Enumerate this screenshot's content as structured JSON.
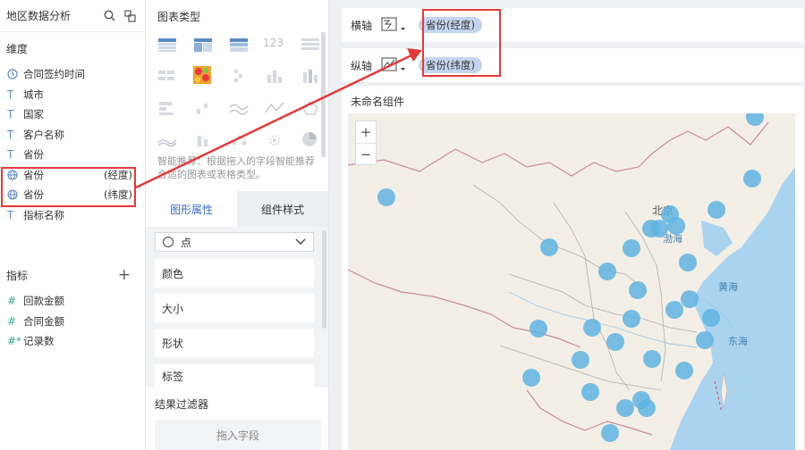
{
  "left": {
    "title": "地区数据分析",
    "dimension_label": "维度",
    "dimensions": [
      {
        "type": "clock",
        "label": "合同签约时间",
        "suffix": ""
      },
      {
        "type": "T",
        "label": "城市",
        "suffix": ""
      },
      {
        "type": "T",
        "label": "国家",
        "suffix": ""
      },
      {
        "type": "T",
        "label": "客户名称",
        "suffix": ""
      },
      {
        "type": "T",
        "label": "省份",
        "suffix": ""
      },
      {
        "type": "globe",
        "label": "省份",
        "suffix": "(经度)"
      },
      {
        "type": "globe",
        "label": "省份",
        "suffix": "(纬度)"
      },
      {
        "type": "T",
        "label": "指标名称",
        "suffix": ""
      }
    ],
    "measure_label": "指标",
    "add_symbol": "+",
    "measures": [
      {
        "type": "#",
        "label": "回款金额"
      },
      {
        "type": "#",
        "label": "合同金额"
      },
      {
        "type": "#*",
        "label": "记录数"
      }
    ]
  },
  "mid": {
    "chart_type_label": "图表类型",
    "number_icon_text": "123",
    "hint": "智能推荐：根据拖入的字段智能推荐合适的图表或表格类型。",
    "tabs": {
      "graph": "图形属性",
      "style": "组件样式"
    },
    "mark_type": "点",
    "props": [
      "颜色",
      "大小",
      "形状",
      "标签"
    ],
    "filter_label": "结果过滤器",
    "drop_hint": "拖入字段"
  },
  "right": {
    "x_axis_label": "横轴",
    "y_axis_label": "纵轴",
    "x_field": "省份(经度)",
    "y_field": "省份(纬度)",
    "widget_title": "未命名组件",
    "zoom_in": "+",
    "zoom_out": "−",
    "map_labels": {
      "beijing": "北京",
      "bohai": "渤海",
      "huanghai": "黄海",
      "donghai": "东海"
    }
  },
  "colors": {
    "accent": "#3d6bc4",
    "highlight": "#e23a3a",
    "point": "#5fb3e0",
    "pill": "#c5d5ef",
    "land": "#f3efe6",
    "sea": "#aad3f0"
  }
}
